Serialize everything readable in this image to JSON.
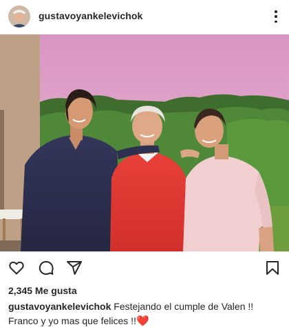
{
  "post": {
    "username": "gustavoyankelevichok",
    "likes_text": "2,345 Me gusta",
    "caption_user": "gustavoyankelevichok",
    "caption_line1": " Festejando el cumple de Valen !!",
    "caption_line2": "Franco y yo mas que felices !!",
    "caption_emoji": "❤️"
  },
  "icons": {
    "more": "more-vertical-icon",
    "like": "heart-icon",
    "comment": "comment-icon",
    "share": "send-icon",
    "save": "bookmark-icon"
  },
  "colors": {
    "text": "#262626",
    "heart_emoji": "#e0245e"
  }
}
